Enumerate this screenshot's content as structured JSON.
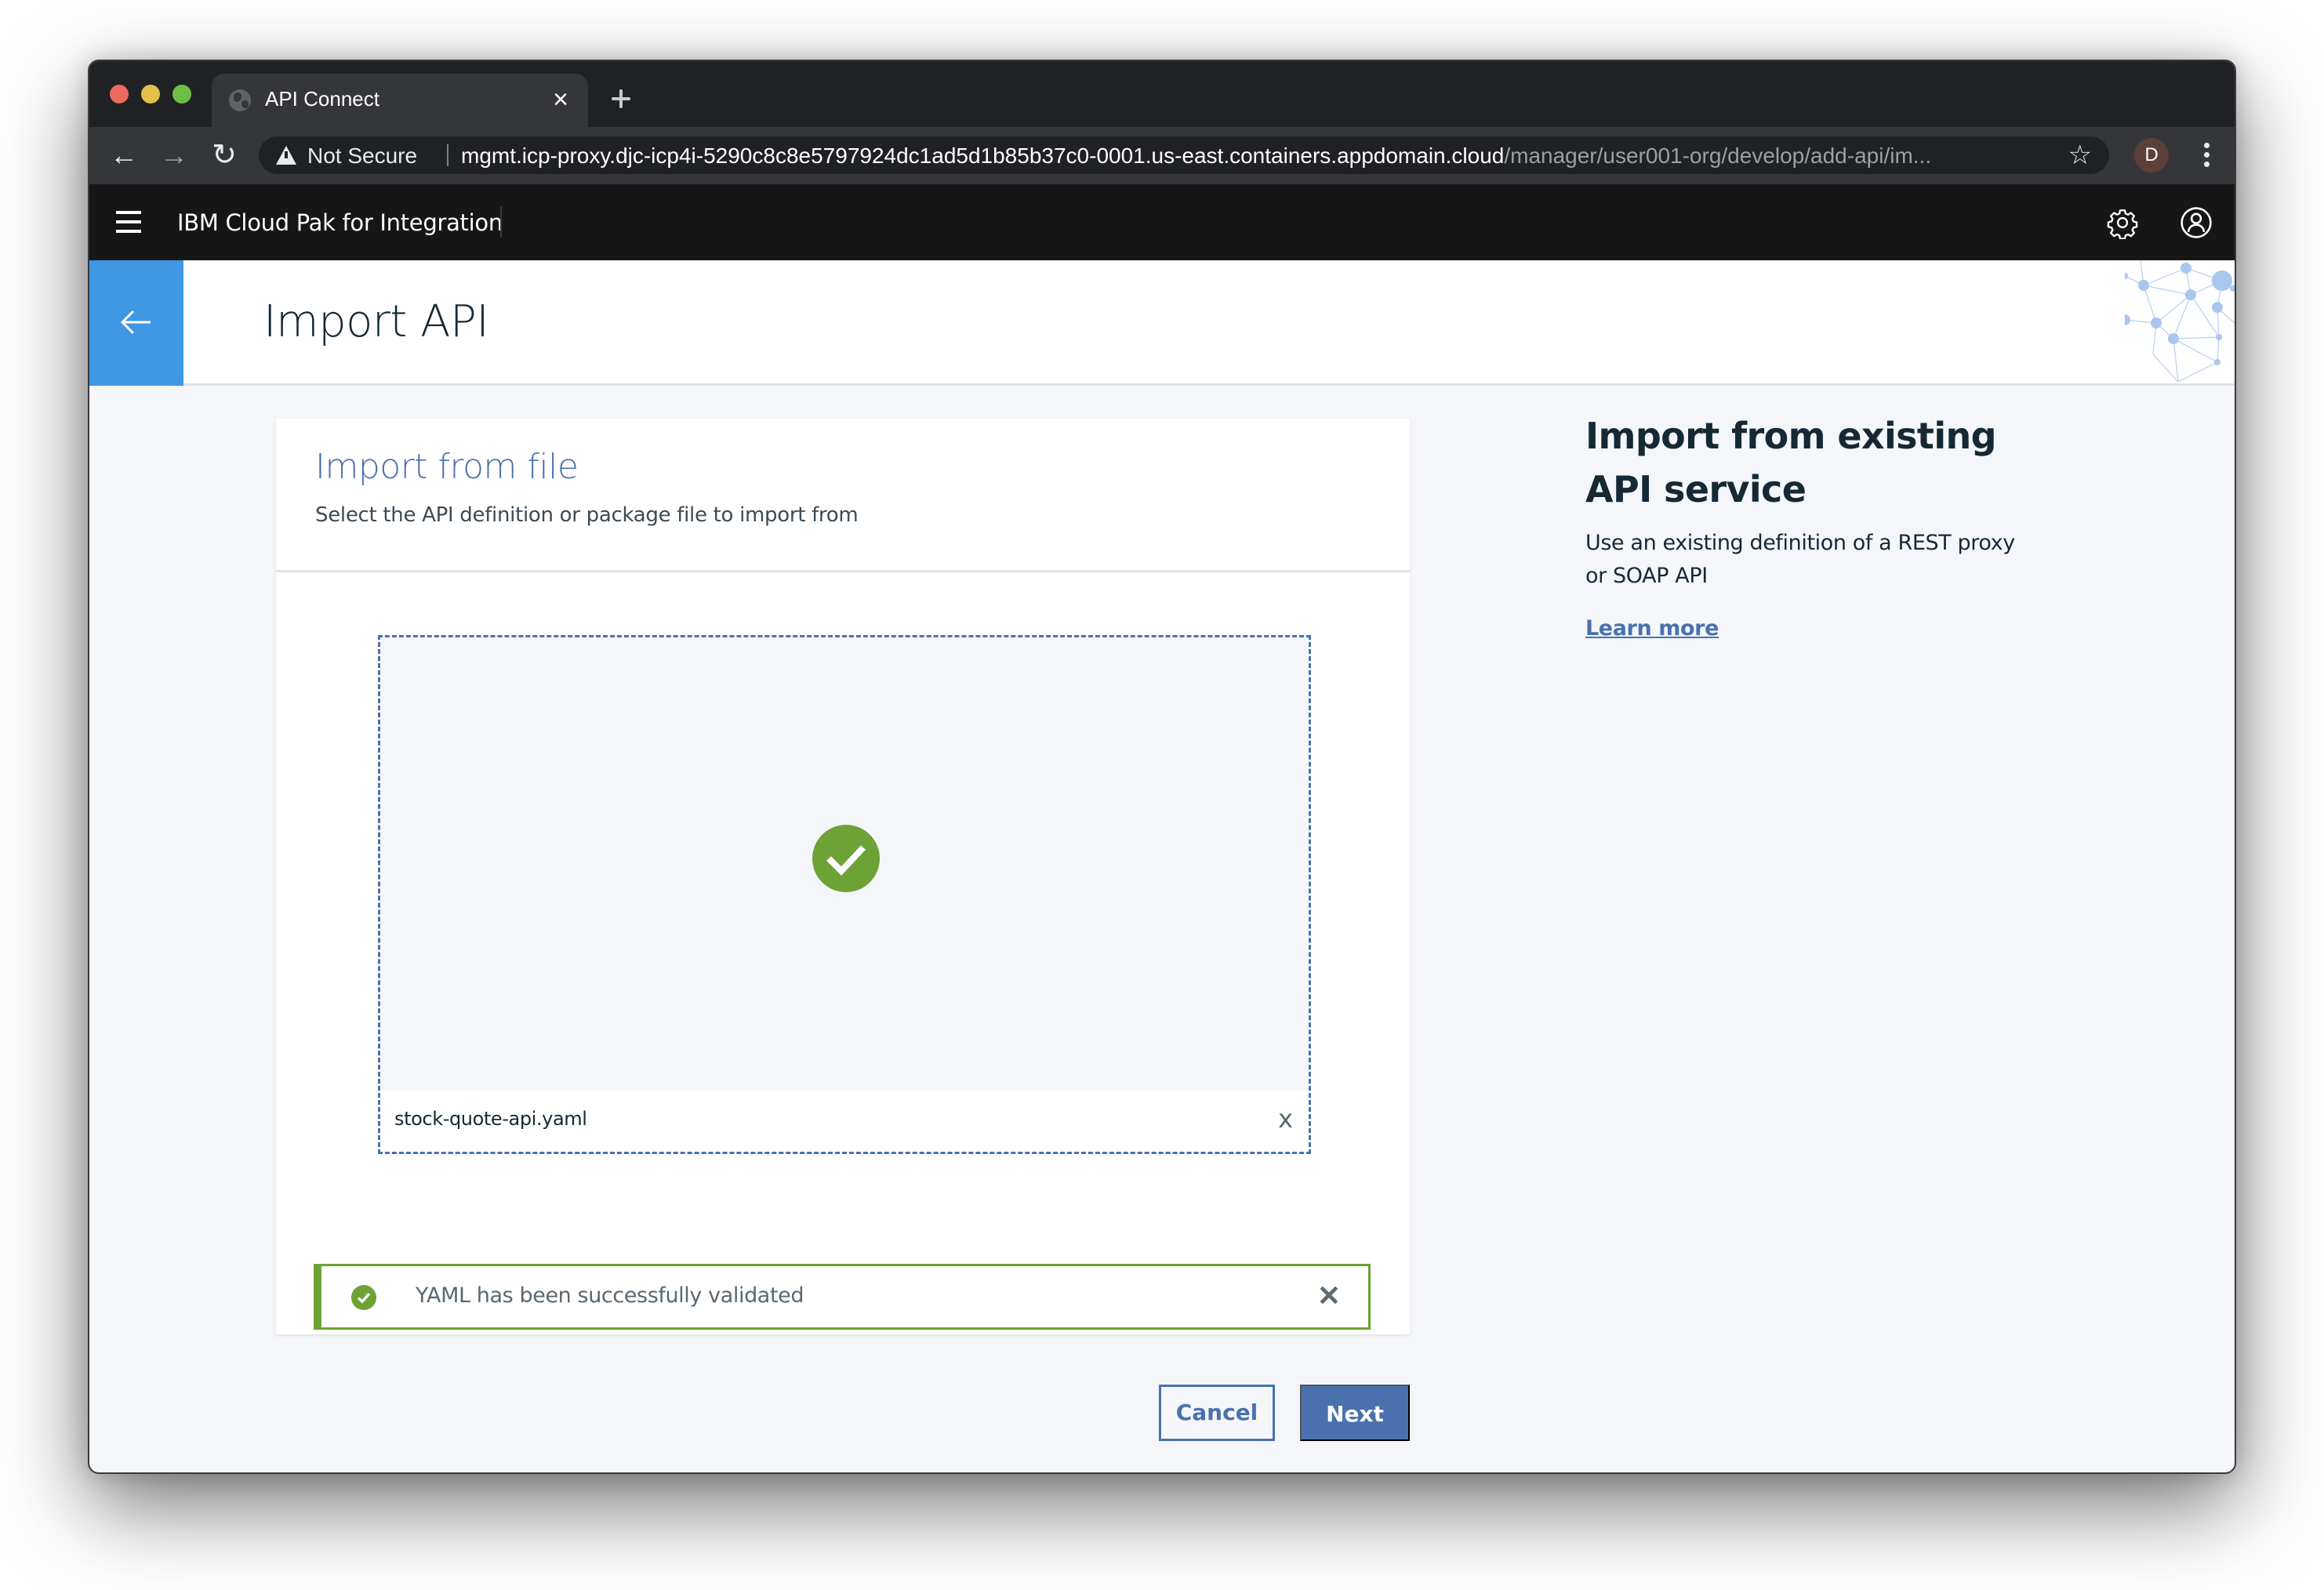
{
  "browser": {
    "tab_title": "API Connect",
    "tab_close_glyph": "×",
    "new_tab_icon": "plus-icon",
    "nav": {
      "back_glyph": "←",
      "forward_glyph": "→",
      "reload_glyph": "↻"
    },
    "security_label": "Not Secure",
    "url_host": "mgmt.icp-proxy.djc-icp4i-5290c8c8e5797924dc1ad5d1b85b37c0-0001.us-east.containers.appdomain.cloud",
    "url_path": "/manager/user001-org/develop/add-api/im...",
    "bookmark_glyph": "☆",
    "profile_initial": "D"
  },
  "app_header": {
    "product_name": "IBM Cloud Pak for Integration",
    "icons": [
      "hamburger-menu-icon",
      "settings-icon",
      "user-profile-icon"
    ]
  },
  "page": {
    "title": "Import API",
    "back_icon": "arrow-left-icon"
  },
  "import_card": {
    "title": "Import from file",
    "subtitle": "Select the API definition or package file to import from",
    "dropzone": {
      "status_icon": "success-check-icon",
      "file_name": "stock-quote-api.yaml",
      "remove_label": "x"
    },
    "notification": {
      "kind": "success",
      "icon": "checkmark-filled-icon",
      "message": "YAML has been successfully validated",
      "close_glyph": "✕"
    }
  },
  "actions": {
    "cancel_label": "Cancel",
    "next_label": "Next"
  },
  "side_panel": {
    "title": "Import from existing API service",
    "description": "Use an existing definition of a REST proxy or SOAP API",
    "link_label": "Learn more"
  },
  "colors": {
    "accent_blue": "#4a71ad",
    "back_button_blue": "#4097e4",
    "success_green": "#6ea136",
    "header_black": "#161616",
    "page_bg": "#f4f6fa"
  }
}
